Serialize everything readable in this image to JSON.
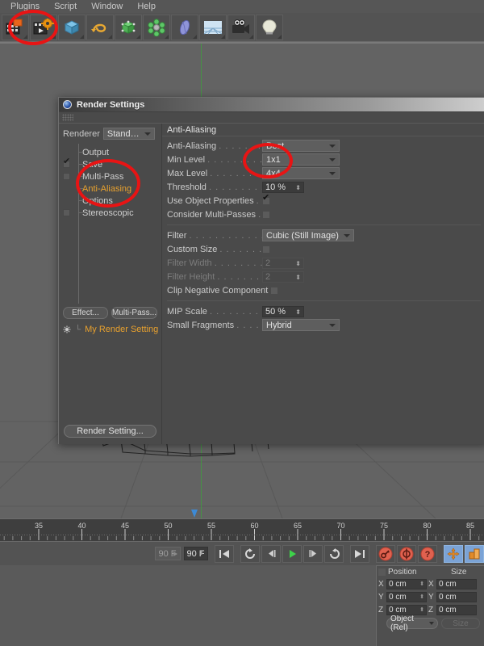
{
  "menubar": {
    "items": [
      {
        "label": "Plugins"
      },
      {
        "label": "Script"
      },
      {
        "label": "Window"
      },
      {
        "label": "Help"
      }
    ]
  },
  "toolbar": {
    "buttons": [
      {
        "name": "render-view-icon",
        "label": "Render View"
      },
      {
        "name": "render-settings-icon",
        "label": "Render Settings"
      },
      {
        "name": "cube-primitive-icon",
        "label": "Cube"
      },
      {
        "name": "spline-icon",
        "label": "Spline"
      },
      {
        "name": "hypernurbs-icon",
        "label": "HyperNURBS"
      },
      {
        "name": "array-object-icon",
        "label": "Array"
      },
      {
        "name": "deformer-icon",
        "label": "Bend"
      },
      {
        "name": "floor-environment-icon",
        "label": "Floor"
      },
      {
        "name": "camera-icon",
        "label": "Camera"
      },
      {
        "name": "light-icon",
        "label": "Light"
      }
    ]
  },
  "dialog": {
    "title": "Render Settings",
    "renderer": {
      "label": "Renderer",
      "value": "Standard"
    },
    "tree": [
      {
        "label": "Output",
        "checkbox": "none",
        "selected": false
      },
      {
        "label": "Save",
        "checkbox": "checked",
        "selected": false
      },
      {
        "label": "Multi-Pass",
        "checkbox": "empty",
        "selected": false
      },
      {
        "label": "Anti-Aliasing",
        "checkbox": "none",
        "selected": true
      },
      {
        "label": "Options",
        "checkbox": "none",
        "selected": false
      },
      {
        "label": "Stereoscopic",
        "checkbox": "empty",
        "selected": false
      }
    ],
    "left_buttons": [
      {
        "label": "Effect..."
      },
      {
        "label": "Multi-Pass..."
      }
    ],
    "render_setting_item": {
      "label": "My Render Setting"
    },
    "bottom_button": {
      "label": "Render Setting..."
    },
    "section": {
      "title": "Anti-Aliasing",
      "rows_top": [
        {
          "label": "Anti-Aliasing",
          "dots": ". . . . . . . . .",
          "type": "dropdown",
          "value": "Best",
          "dim": false
        },
        {
          "label": "Min Level",
          "dots": ". . . . . . . . . . . .",
          "type": "dropdown",
          "value": "1x1",
          "dim": false
        },
        {
          "label": "Max Level",
          "dots": ". . . . . . . . . . .",
          "type": "dropdown",
          "value": "4x4",
          "dim": false
        },
        {
          "label": "Threshold",
          "dots": ". . . . . . . . . . . . .",
          "type": "number",
          "value": "10 %",
          "dim": false
        },
        {
          "label": "Use Object Properties",
          "dots": ". . .",
          "type": "checkbox",
          "value": "on",
          "dim": false
        },
        {
          "label": "Consider Multi-Passes",
          "dots": ". . .",
          "type": "checkbox",
          "value": "off",
          "dim": false
        }
      ],
      "rows_mid": [
        {
          "label": "Filter",
          "dots": ". . . . . . . . . . . . . .",
          "type": "dropdown-wide",
          "value": "Cubic (Still Image)",
          "dim": false
        },
        {
          "label": "Custom Size",
          "dots": ". . . . . . . . . .",
          "type": "checkbox",
          "value": "off",
          "dim": false
        },
        {
          "label": "Filter Width",
          "dots": ". . . . . . . . . . .",
          "type": "number",
          "value": "2",
          "dim": true
        },
        {
          "label": "Filter Height",
          "dots": ". . . . . . . . . .",
          "type": "number",
          "value": "2",
          "dim": true
        },
        {
          "label": "Clip Negative Component",
          "dots": "",
          "type": "checkbox",
          "value": "off",
          "dim": false
        }
      ],
      "rows_bottom": [
        {
          "label": "MIP Scale",
          "dots": ". . . . . . . . . . . . .",
          "type": "number",
          "value": "50 %",
          "dim": false
        },
        {
          "label": "Small Fragments",
          "dots": ". . . . . . .",
          "type": "dropdown",
          "value": "Hybrid",
          "dim": false
        }
      ]
    }
  },
  "timeline": {
    "ticks": [
      35,
      40,
      45,
      50,
      55,
      60,
      65,
      70,
      75,
      80,
      85
    ],
    "playhead_frame": 53
  },
  "transport": {
    "range_end_label": "90 F",
    "current_frame_label": "90 F",
    "buttons": [
      {
        "name": "go-to-start-button",
        "label": "Go to Start"
      },
      {
        "name": "play-backwards-button",
        "label": "Play Backwards"
      },
      {
        "name": "step-back-button",
        "label": "Previous Frame"
      },
      {
        "name": "play-button",
        "label": "Play Forwards"
      },
      {
        "name": "step-forward-button",
        "label": "Next Frame"
      },
      {
        "name": "loop-button",
        "label": "Loop"
      },
      {
        "name": "go-to-end-button",
        "label": "Go to End"
      },
      {
        "name": "record-keyframe-button",
        "label": "Record Active Objects"
      },
      {
        "name": "autokeying-button",
        "label": "Autokeying"
      },
      {
        "name": "keyframe-selection-button",
        "label": "Keyframe Selection"
      },
      {
        "name": "position-key-toggle",
        "label": "Position"
      },
      {
        "name": "scale-key-toggle",
        "label": "Scale"
      }
    ]
  },
  "coords": {
    "position_header": "Position",
    "size_header": "Size",
    "axes": [
      "X",
      "Y",
      "Z"
    ],
    "position_values": [
      "0 cm",
      "0 cm",
      "0 cm"
    ],
    "size_values": [
      "0 cm",
      "0 cm",
      "0 cm"
    ],
    "mode_dropdown": "Object (Rel)",
    "apply_button": "Size"
  },
  "colors": {
    "accent_orange": "#e8a12e",
    "annotation_red": "#e81414",
    "play_green": "#3ed24a",
    "axis_green": "#3f9a3f",
    "selection_blue": "#7ba3d6",
    "keyframe_red": "#e0614f",
    "panel_bg": "#4a4a4a",
    "viewport_bg": "#636363"
  }
}
